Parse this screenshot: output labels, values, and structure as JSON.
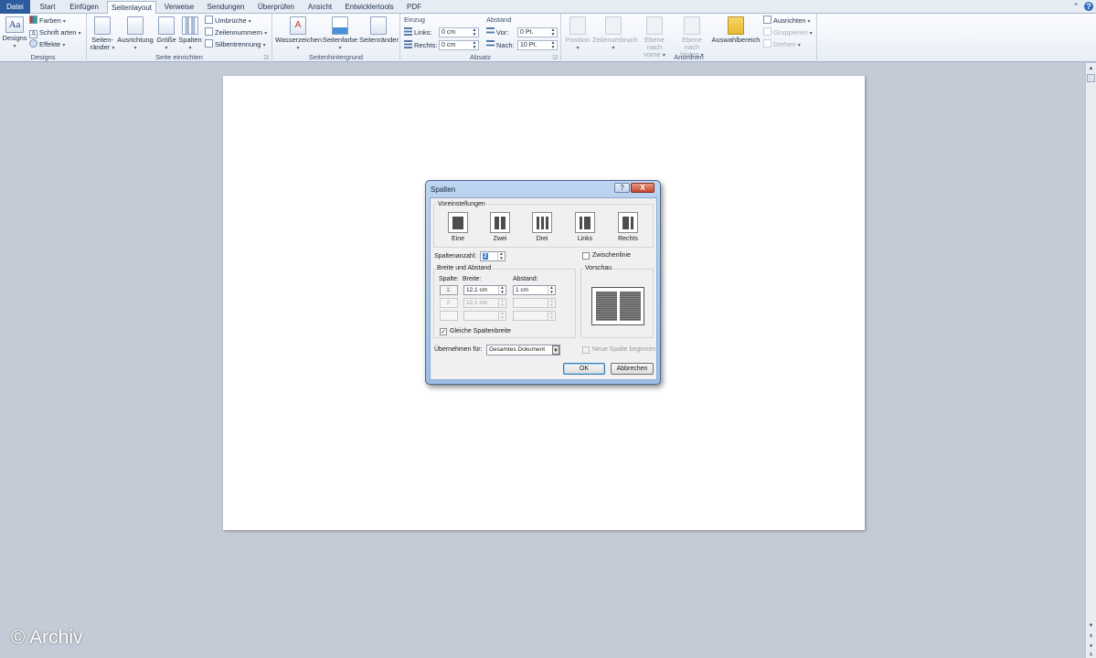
{
  "tabs": [
    "Datei",
    "Start",
    "Einfügen",
    "Seitenlayout",
    "Verweise",
    "Sendungen",
    "Überprüfen",
    "Ansicht",
    "Entwicklertools",
    "PDF"
  ],
  "active_tab": "Seitenlayout",
  "ribbon": {
    "designs": {
      "label": "Designs",
      "button": "Designs",
      "farben": "Farben",
      "schriftarten": "Schrift arten",
      "effekte": "Effekte"
    },
    "seite_einrichten": {
      "label": "Seite einrichten",
      "seitenraender": "Seiten-",
      "seitenraender2": "ränder",
      "ausrichtung": "Ausrichtung",
      "groesse": "Größe",
      "spalten": "Spalten",
      "umbrueche": "Umbrüche",
      "zeilennummern": "Zeilennummern",
      "silbentrennung": "Silbentrennung"
    },
    "seitenhintergrund": {
      "label": "Seitenhintergrund",
      "wasserzeichen": "Wasserzeichen",
      "seitenfarbe": "Seitenfarbe",
      "seitenraender": "Seitenränder"
    },
    "absatz": {
      "label": "Absatz",
      "einzug": "Einzug",
      "links_label": "Links:",
      "links_value": "0 cm",
      "rechts_label": "Rechts:",
      "rechts_value": "0 cm",
      "abstand": "Abstand",
      "vor_label": "Vor:",
      "vor_value": "0 Pt.",
      "nach_label": "Nach:",
      "nach_value": "10 Pt."
    },
    "anordnen": {
      "label": "Anordnen",
      "position": "Position",
      "zeilenumbruch": "Zeilenumbruch",
      "ebene_vorne": "Ebene nach",
      "ebene_vorne2": "vorne",
      "ebene_hinten": "Ebene nach",
      "ebene_hinten2": "hinten",
      "auswahlbereich": "Auswahlbereich",
      "ausrichten": "Ausrichten",
      "gruppieren": "Gruppieren",
      "drehen": "Drehen"
    }
  },
  "dialog": {
    "title": "Spalten",
    "help": "?",
    "close": "X",
    "voreinstellungen": "Voreinstellungen",
    "presets": [
      "Eine",
      "Zwei",
      "Drei",
      "Links",
      "Rechts"
    ],
    "spaltenanzahl_label": "Spaltenanzahl:",
    "spaltenanzahl_value": "2",
    "zwischenlinie": "Zwischenlinie",
    "breite_und_abstand": "Breite und Abstand",
    "vorschau": "Vorschau",
    "col_spalte": "Spalte:",
    "col_breite": "Breite:",
    "col_abstand": "Abstand:",
    "rows": [
      {
        "num": "1:",
        "breite": "12,1 cm",
        "abstand": "1 cm"
      },
      {
        "num": "2:",
        "breite": "12,1 cm",
        "abstand": ""
      },
      {
        "num": "",
        "breite": "",
        "abstand": ""
      }
    ],
    "gleiche_spaltenbreite": "Gleiche Spaltenbreite",
    "uebernehmen_label": "Übernehmen für:",
    "uebernehmen_value": "Gesamtes Dokument",
    "neue_spalte": "Neue Spalte beginnen",
    "ok": "OK",
    "abbrechen": "Abbrechen"
  },
  "watermark": "© Archiv",
  "colors": {
    "file_tab": "#2d5c9e",
    "workspace": "#c4cbd6",
    "dialog_frame": "#9ebde6"
  }
}
